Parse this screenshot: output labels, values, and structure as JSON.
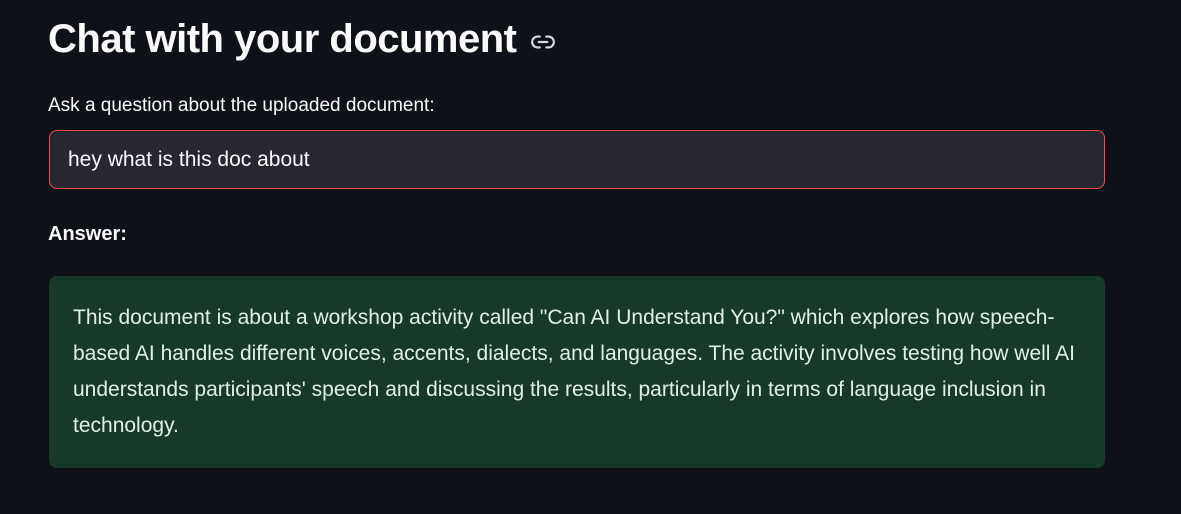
{
  "header": {
    "title": "Chat with your document",
    "link_icon": "link-icon"
  },
  "question": {
    "label": "Ask a question about the uploaded document:",
    "value": "hey what is this doc about"
  },
  "answer": {
    "label": "Answer:",
    "text": "This document is about a workshop activity called \"Can AI Understand You?\" which explores how speech-based AI handles different voices, accents, dialects, and languages. The activity involves testing how well AI understands participants' speech and discussing the results, particularly in terms of language inclusion in technology."
  },
  "colors": {
    "background": "#0e1117",
    "input_background": "#262730",
    "input_border_focus": "#ff4b4b",
    "answer_background": "#173928",
    "answer_text": "#dff1e6"
  }
}
